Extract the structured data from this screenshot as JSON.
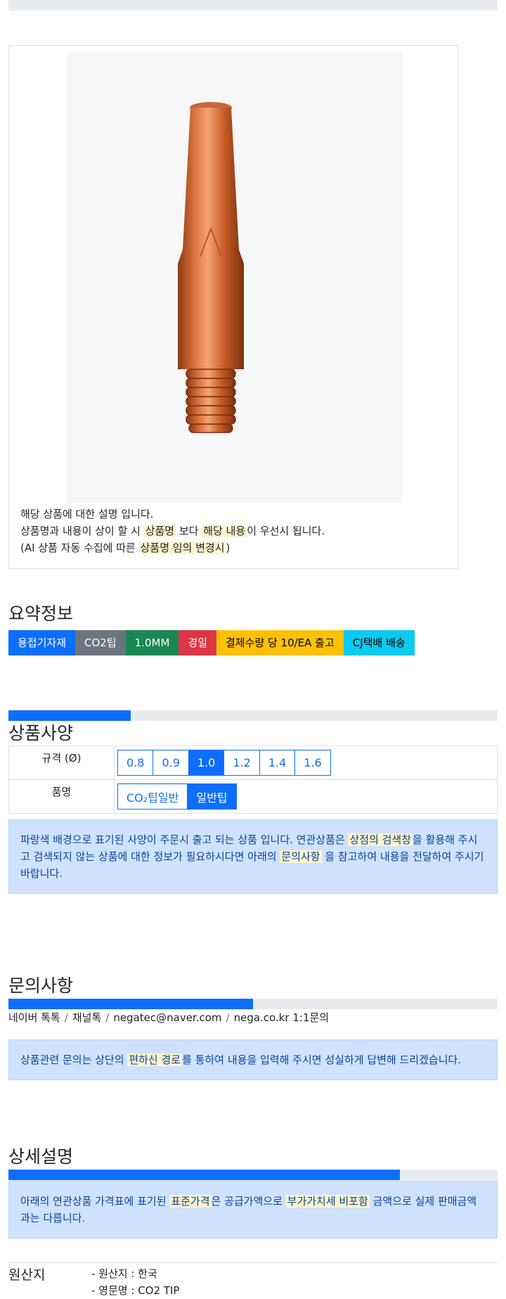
{
  "product_image": {
    "alt": "CO2 welding contact tip (copper)"
  },
  "description": {
    "line1": "해당 상품에 대한 설명 입니다.",
    "line2": {
      "pre": "상품명과 내용이 상이 할 시",
      "hl1": "상품명",
      "mid": "보다",
      "hl2": "해당 내용",
      "post": "이 우선시 됩니다."
    },
    "line3": {
      "pre": "(AI 상품 자동 수집에 따른",
      "hl": "상품명 임의 변경시",
      "post": ")"
    }
  },
  "summary": {
    "title": "요약정보",
    "badges": [
      {
        "label": "용접기자재",
        "bg": "#0d6efd",
        "fg": "#ffffff"
      },
      {
        "label": "CO2팁",
        "bg": "#6c757d",
        "fg": "#ffffff"
      },
      {
        "label": "1.0MM",
        "bg": "#198754",
        "fg": "#ffffff"
      },
      {
        "label": "경일",
        "bg": "#dc3545",
        "fg": "#ffffff"
      },
      {
        "label": "결제수량 당 10/EA 출고",
        "bg": "#ffc107",
        "fg": "#000000"
      },
      {
        "label": "CJ택배 배송",
        "bg": "#0dcaf0",
        "fg": "#000000"
      }
    ]
  },
  "spec": {
    "title": "상품사양",
    "progress_fraction": 0.25,
    "rows": [
      {
        "label": "규격 (Ø)",
        "options": [
          "0.8",
          "0.9",
          "1.0",
          "1.2",
          "1.4",
          "1.6"
        ],
        "selected": "1.0"
      },
      {
        "label": "품명",
        "options": [
          "CO₂팁일반",
          "일반팁"
        ],
        "selected": "일반팁"
      }
    ],
    "alert": {
      "pre": "파랑색 배경으로 표기된 사양이 주문시 출고 되는 상품 입니다. 연관상품은",
      "hl1": "상점의 검색창",
      "mid": "을 활용해 주시고 검색되지 않는 상품에 대한 정보가 필요하시다면 아래의",
      "hl2": "문의사항",
      "post": "을 참고하여 내용을 전달하여 주시기 바랍니다."
    }
  },
  "inquiry": {
    "title": "문의사항",
    "progress_fraction": 0.5,
    "contacts": [
      "네이버 톡톡",
      "채널톡",
      "negatec@naver.com",
      "nega.co.kr 1:1문의"
    ],
    "alert": {
      "pre": "상품관련 문의는 상단의",
      "hl": "편하신 경로",
      "post": "를 통하여 내용을 입력해 주시면 성실하게 답변해 드리겠습니다."
    }
  },
  "detail": {
    "title": "상세설명",
    "progress_fraction": 0.8,
    "alert": {
      "pre": "아래의 연관상품 가격표에 표기된",
      "hl1": "표준가격",
      "mid": "은 공급가액으로",
      "hl2": "부가가치세 비포함",
      "post": "금액으로 실제 판매금액과는 다릅니다."
    }
  },
  "origin": {
    "label": "원산지",
    "items": [
      "- 원산지 : 한국",
      "- 영문명 : CO2 TIP"
    ]
  }
}
